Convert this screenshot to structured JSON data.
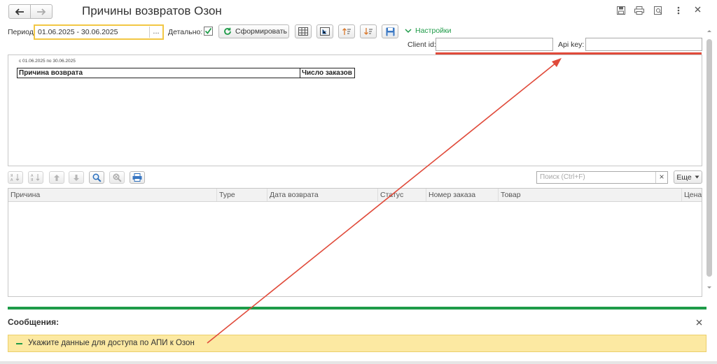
{
  "window": {
    "title": "Причины возвратов Озон"
  },
  "toolbar": {
    "period_label": "Период:",
    "period_value": "01.06.2025 - 30.06.2025",
    "ellipsis": "...",
    "detail_label": "Детально:",
    "detail_checked": true,
    "generate_label": "Сформировать",
    "settings_label": "Настройки"
  },
  "api": {
    "client_id_label": "Client id:",
    "client_id_value": "",
    "api_key_label": "Api key:",
    "api_key_value": ""
  },
  "report": {
    "period_caption": "с 01.06.2025 по 30.06.2025",
    "columns": [
      "Причина возврата",
      "Число заказов"
    ]
  },
  "list": {
    "search_placeholder": "Поиск (Ctrl+F)",
    "search_clear": "×",
    "more_label": "Еще",
    "columns": [
      "Причина",
      "Type",
      "Дата возврата",
      "Статус",
      "Номер заказа",
      "Товар",
      "Цена"
    ]
  },
  "messages": {
    "title": "Сообщения:",
    "items": [
      "Укажите данные для доступа по АПИ к Озон"
    ]
  },
  "colors": {
    "accent_green": "#1e9b48",
    "annotation_red": "#e04a3a",
    "message_bg": "#fce9a2",
    "period_border": "#f2c744"
  }
}
